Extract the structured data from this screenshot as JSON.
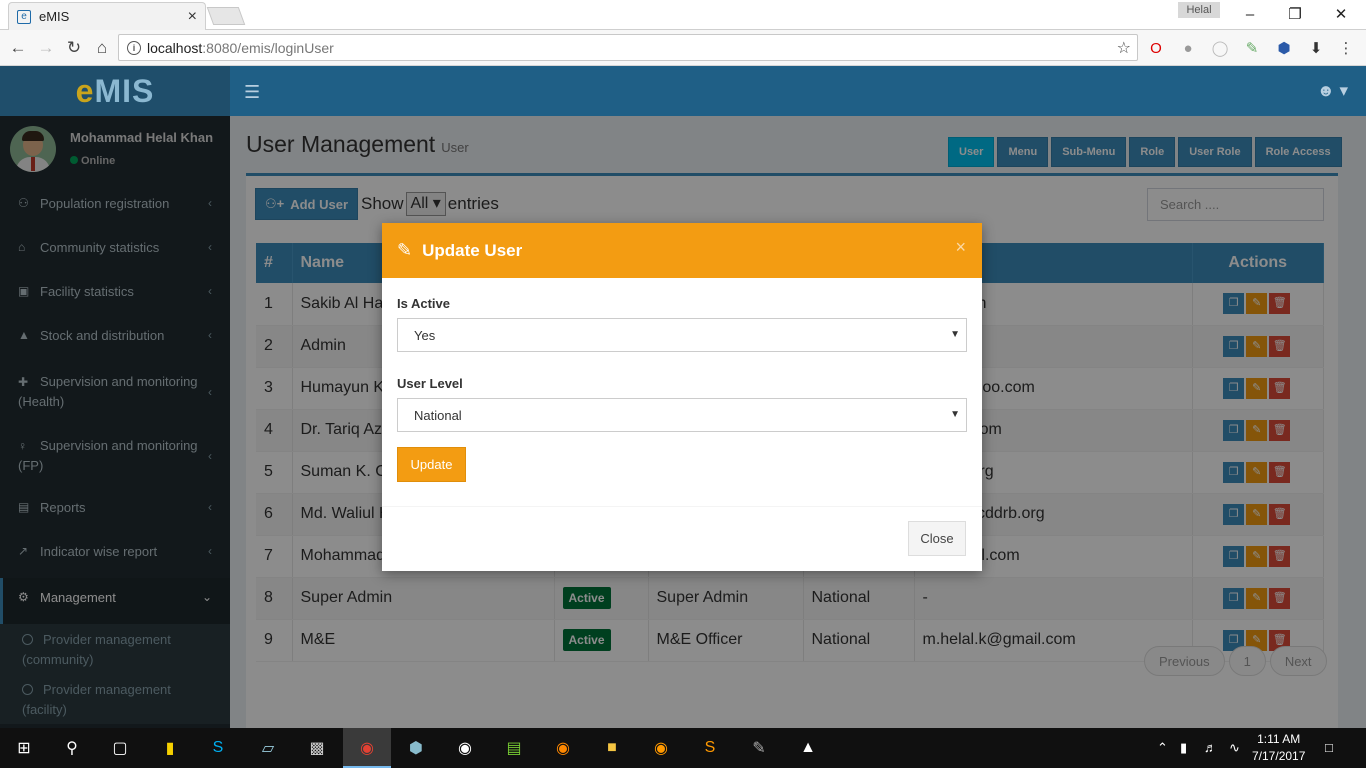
{
  "browser": {
    "tab_title": "eMIS",
    "tab_close": "×",
    "profile_name": "Helal",
    "url_host": "localhost",
    "url_path": ":8080/emis/loginUser"
  },
  "app": {
    "logo_e": "e",
    "logo_rest": "MIS"
  },
  "sidebar": {
    "user_name": "Mohammad Helal Khan",
    "user_status": "Online",
    "items": [
      {
        "label": "Population registration",
        "icon": "users-icon"
      },
      {
        "label": "Community statistics",
        "icon": "home-icon"
      },
      {
        "label": "Facility statistics",
        "icon": "hospital-icon"
      },
      {
        "label": "Stock and distribution",
        "icon": "flask-icon"
      },
      {
        "label": "Supervision and monitoring (Health)",
        "icon": "plus-icon"
      },
      {
        "label": "Supervision and monitoring (FP)",
        "icon": "female-icon"
      },
      {
        "label": "Reports",
        "icon": "report-icon"
      },
      {
        "label": "Indicator wise report",
        "icon": "line-chart-icon"
      },
      {
        "label": "Management",
        "icon": "cogs-icon"
      }
    ],
    "subitems": [
      "Provider management (community)",
      "Provider management (facility)"
    ]
  },
  "page": {
    "title": "User Management",
    "subtitle": "User",
    "tabs": [
      "User",
      "Menu",
      "Sub-Menu",
      "Role",
      "User Role",
      "Role Access"
    ],
    "add_user": "Add User",
    "show": "Show",
    "show_value": "All",
    "entries": "entries",
    "search_placeholder": "Search ....",
    "columns": [
      "#",
      "Name",
      "",
      "",
      "",
      "",
      "Actions"
    ],
    "rows": [
      {
        "n": "1",
        "name": "Sakib Al Ha",
        "status": "",
        "role": "",
        "level": "",
        "email": "amil.com"
      },
      {
        "n": "2",
        "name": "Admin",
        "status": "",
        "role": "",
        "level": "",
        "email": ""
      },
      {
        "n": "3",
        "name": "Humayun K",
        "status": "",
        "role": "",
        "level": "",
        "email": "bir@yahoo.com"
      },
      {
        "n": "4",
        "name": "Dr. Tariq Azi",
        "status": "",
        "role": "",
        "level": "",
        "email": "m@jsi.com"
      },
      {
        "n": "5",
        "name": "Suman K. C",
        "status": "",
        "role": "",
        "level": "",
        "email": "icddrb.org"
      },
      {
        "n": "6",
        "name": "Md. Waliul H",
        "status": "",
        "role": "",
        "level": "",
        "email": "asan@icddrb.org"
      },
      {
        "n": "7",
        "name": "Mohammad",
        "status": "",
        "role": "",
        "level": "",
        "email": "k@gmail.com"
      },
      {
        "n": "8",
        "name": "Super Admin",
        "status": "Active",
        "role": "Super Admin",
        "level": "National",
        "email": "-"
      },
      {
        "n": "9",
        "name": "M&E",
        "status": "Active",
        "role": "M&E Officer",
        "level": "National",
        "email": "m.helal.k@gmail.com"
      }
    ],
    "pager": {
      "previous": "Previous",
      "page": "1",
      "next": "Next"
    }
  },
  "modal": {
    "title": "Update User",
    "close_x": "×",
    "is_active_label": "Is Active",
    "is_active_value": "Yes",
    "user_level_label": "User Level",
    "user_level_value": "National",
    "update_button": "Update",
    "close_button": "Close"
  },
  "taskbar": {
    "time": "1:11 AM",
    "date": "7/17/2017"
  }
}
